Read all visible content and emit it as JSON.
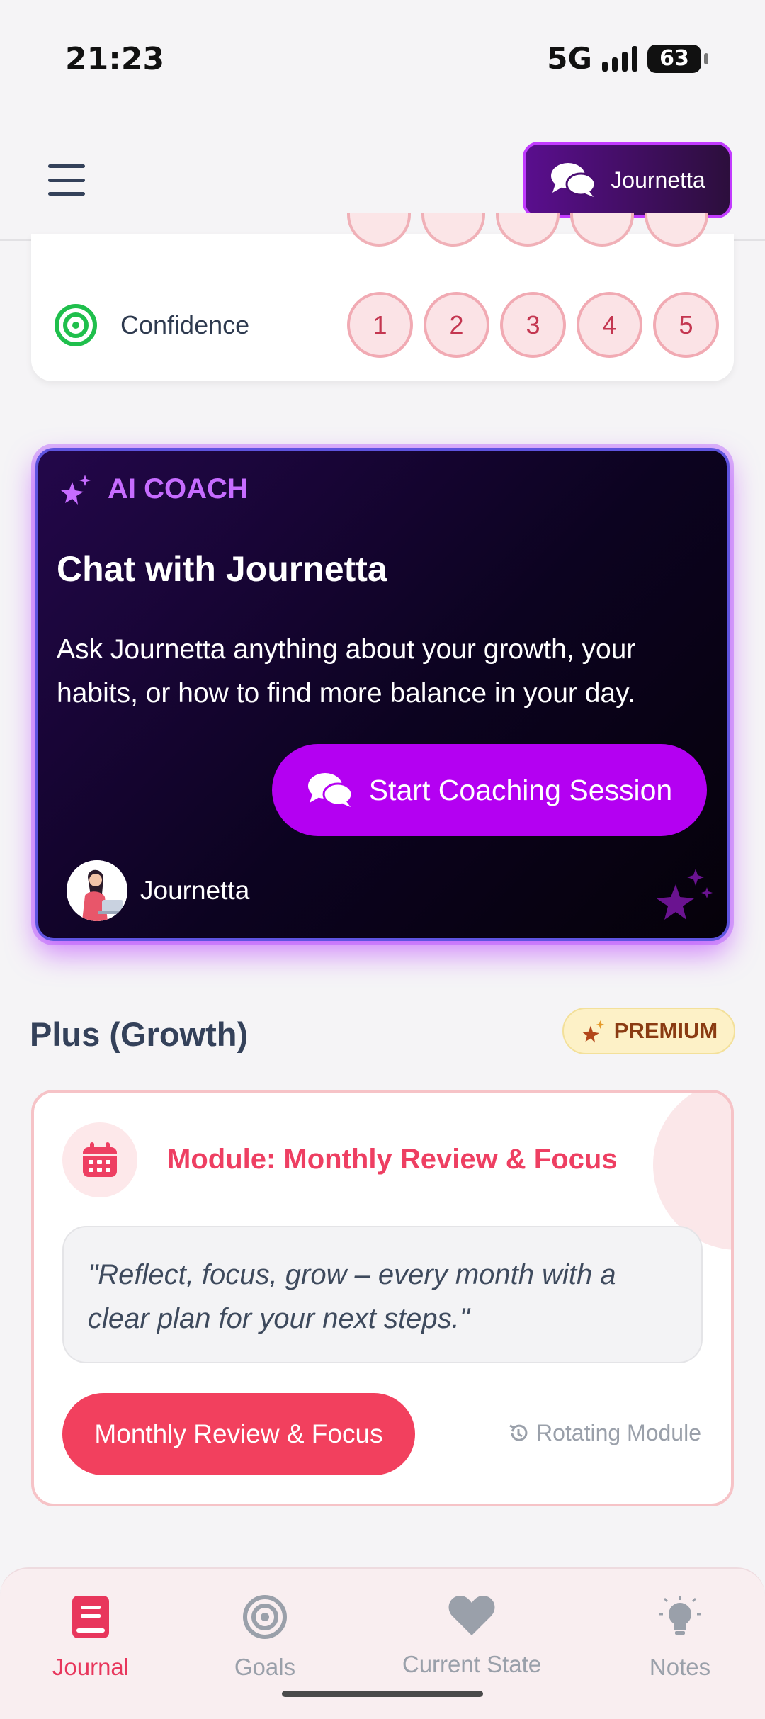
{
  "status_bar": {
    "time": "21:23",
    "network": "5G",
    "battery": "63"
  },
  "header": {
    "coach_button_label": "Journetta"
  },
  "confidence": {
    "label": "Confidence",
    "ratings": [
      "1",
      "2",
      "3",
      "4",
      "5"
    ]
  },
  "ai_coach": {
    "tag": "AI COACH",
    "title": "Chat with Journetta",
    "description": "Ask Journetta anything about your growth, your habits, or how to find more balance in your day.",
    "button_label": "Start Coaching Session",
    "coach_name": "Journetta"
  },
  "plus": {
    "title": "Plus (Growth)",
    "badge": "PREMIUM",
    "module": {
      "title": "Module: Monthly Review & Focus",
      "quote": "\"Reflect, focus, grow – every month with a clear plan for your next steps.\"",
      "button_label": "Monthly Review & Focus",
      "note": "Rotating Module"
    }
  },
  "bottom_nav": {
    "items": [
      {
        "label": "Journal",
        "icon": "journal-icon",
        "active": true
      },
      {
        "label": "Goals",
        "icon": "target-icon",
        "active": false
      },
      {
        "label": "Current State",
        "icon": "heart-icon",
        "active": false
      },
      {
        "label": "Notes",
        "icon": "lightbulb-icon",
        "active": false
      }
    ]
  },
  "colors": {
    "accent": "#e8365c",
    "coach_purple": "#b400f2",
    "premium_bg": "#fdf1c7"
  }
}
